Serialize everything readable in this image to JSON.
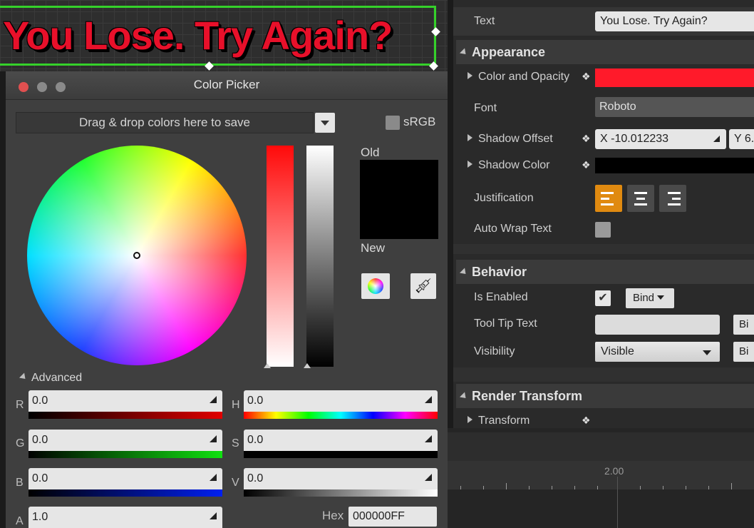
{
  "canvas": {
    "preview_text": "You Lose. Try Again?",
    "text_color": "#e8102a",
    "selection_color": "#35d12a"
  },
  "color_picker": {
    "title": "Color Picker",
    "saved_colors_hint": "Drag & drop colors here to save",
    "srgb_label": "sRGB",
    "srgb_checked": false,
    "old_label": "Old",
    "new_label": "New",
    "old_color": "#000000",
    "advanced_label": "Advanced",
    "channels": {
      "r": {
        "label": "R",
        "value": "0.0"
      },
      "g": {
        "label": "G",
        "value": "0.0"
      },
      "b": {
        "label": "B",
        "value": "0.0"
      },
      "a": {
        "label": "A",
        "value": "1.0"
      },
      "h": {
        "label": "H",
        "value": "0.0"
      },
      "s": {
        "label": "S",
        "value": "0.0"
      },
      "v": {
        "label": "V",
        "value": "0.0"
      }
    },
    "hex_label": "Hex",
    "hex_value": "000000FF"
  },
  "details": {
    "text_label": "Text",
    "text_value": "You Lose. Try Again?",
    "appearance": {
      "header": "Appearance",
      "color_opacity_label": "Color and Opacity",
      "color_opacity_value": "#ff1a2a",
      "font_label": "Font",
      "font_value": "Roboto",
      "shadow_offset_label": "Shadow Offset",
      "shadow_offset_x": "X  -10.012233",
      "shadow_offset_y": "Y  6.",
      "shadow_color_label": "Shadow Color",
      "shadow_color_value": "#000000",
      "justification_label": "Justification",
      "justification_active": "left",
      "auto_wrap_label": "Auto Wrap Text",
      "auto_wrap_checked": false
    },
    "behavior": {
      "header": "Behavior",
      "is_enabled_label": "Is Enabled",
      "is_enabled_checked": true,
      "bind_label": "Bind",
      "tool_tip_label": "Tool Tip Text",
      "tool_tip_value": "",
      "tool_tip_bind": "Bi",
      "visibility_label": "Visibility",
      "visibility_value": "Visible",
      "visibility_bind": "Bi"
    },
    "render_transform": {
      "header": "Render Transform",
      "transform_label": "Transform"
    }
  },
  "timeline": {
    "time_label": "2.00"
  }
}
